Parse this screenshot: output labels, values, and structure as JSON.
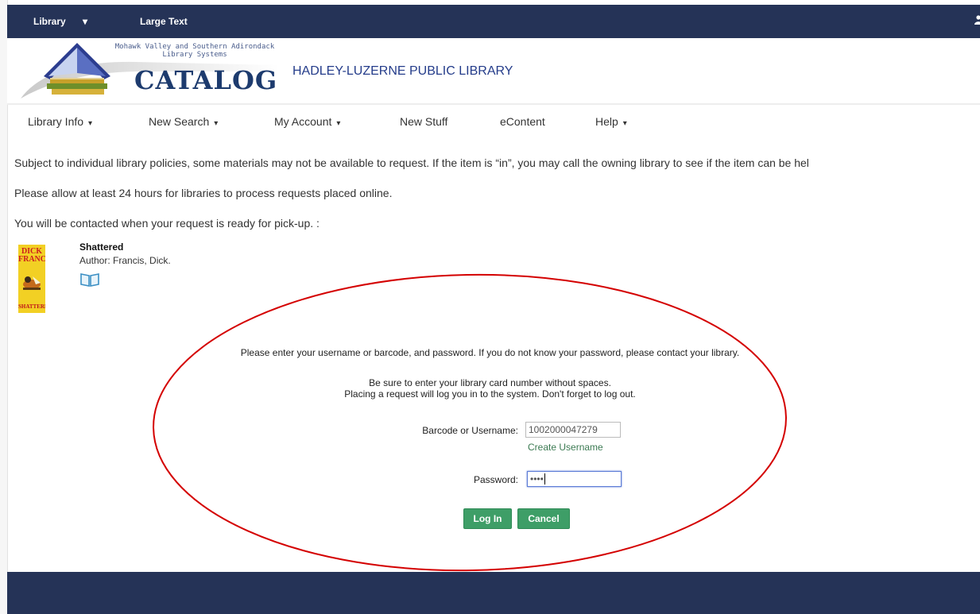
{
  "topbar": {
    "library_label": "Library",
    "library_caret": "▾",
    "large_text": "Large Text"
  },
  "header": {
    "logo_subtitle_1": "Mohawk Valley and Southern Adirondack",
    "logo_subtitle_2": "Library Systems",
    "logo_catalog": "CATALOG",
    "library_name": "HADLEY-LUZERNE PUBLIC LIBRARY"
  },
  "nav": {
    "tabs": [
      {
        "label": "Library Info",
        "caret": "▾"
      },
      {
        "label": "New Search",
        "caret": "▾"
      },
      {
        "label": "My Account",
        "caret": "▾"
      },
      {
        "label": "New Stuff"
      },
      {
        "label": "eContent"
      },
      {
        "label": "Help",
        "caret": "▾"
      }
    ]
  },
  "notices": [
    "Subject to individual library policies, some materials may not be available to request. If the item is “in”, you may call the owning library to see if the item can be hel",
    "Please allow at least 24 hours for libraries to process requests placed online.",
    "You will be contacted when your request is ready for pick-up. :"
  ],
  "item": {
    "title": "Shattered",
    "author_label": "Author:",
    "author": "Francis, Dick.",
    "cover_line1": "DICK",
    "cover_line2": "FRANCIS",
    "cover_bottom": "SHATTERED",
    "book_icon": "book-open-icon"
  },
  "login": {
    "instructions": "Please enter your username or barcode, and password. If you do not know your password, please contact your library.",
    "note_1": "Be sure to enter your library card number without spaces.",
    "note_2": "Placing a request will log you in to the system. Don't forget to log out.",
    "username_label": "Barcode or Username:",
    "username_value": "1002000047279",
    "create_username": "Create Username",
    "password_label": "Password:",
    "password_value": "••••",
    "login_button": "Log In",
    "cancel_button": "Cancel"
  },
  "colors": {
    "topbar": "#253357",
    "button": "#3e9e67",
    "annotation": "#d40000"
  }
}
